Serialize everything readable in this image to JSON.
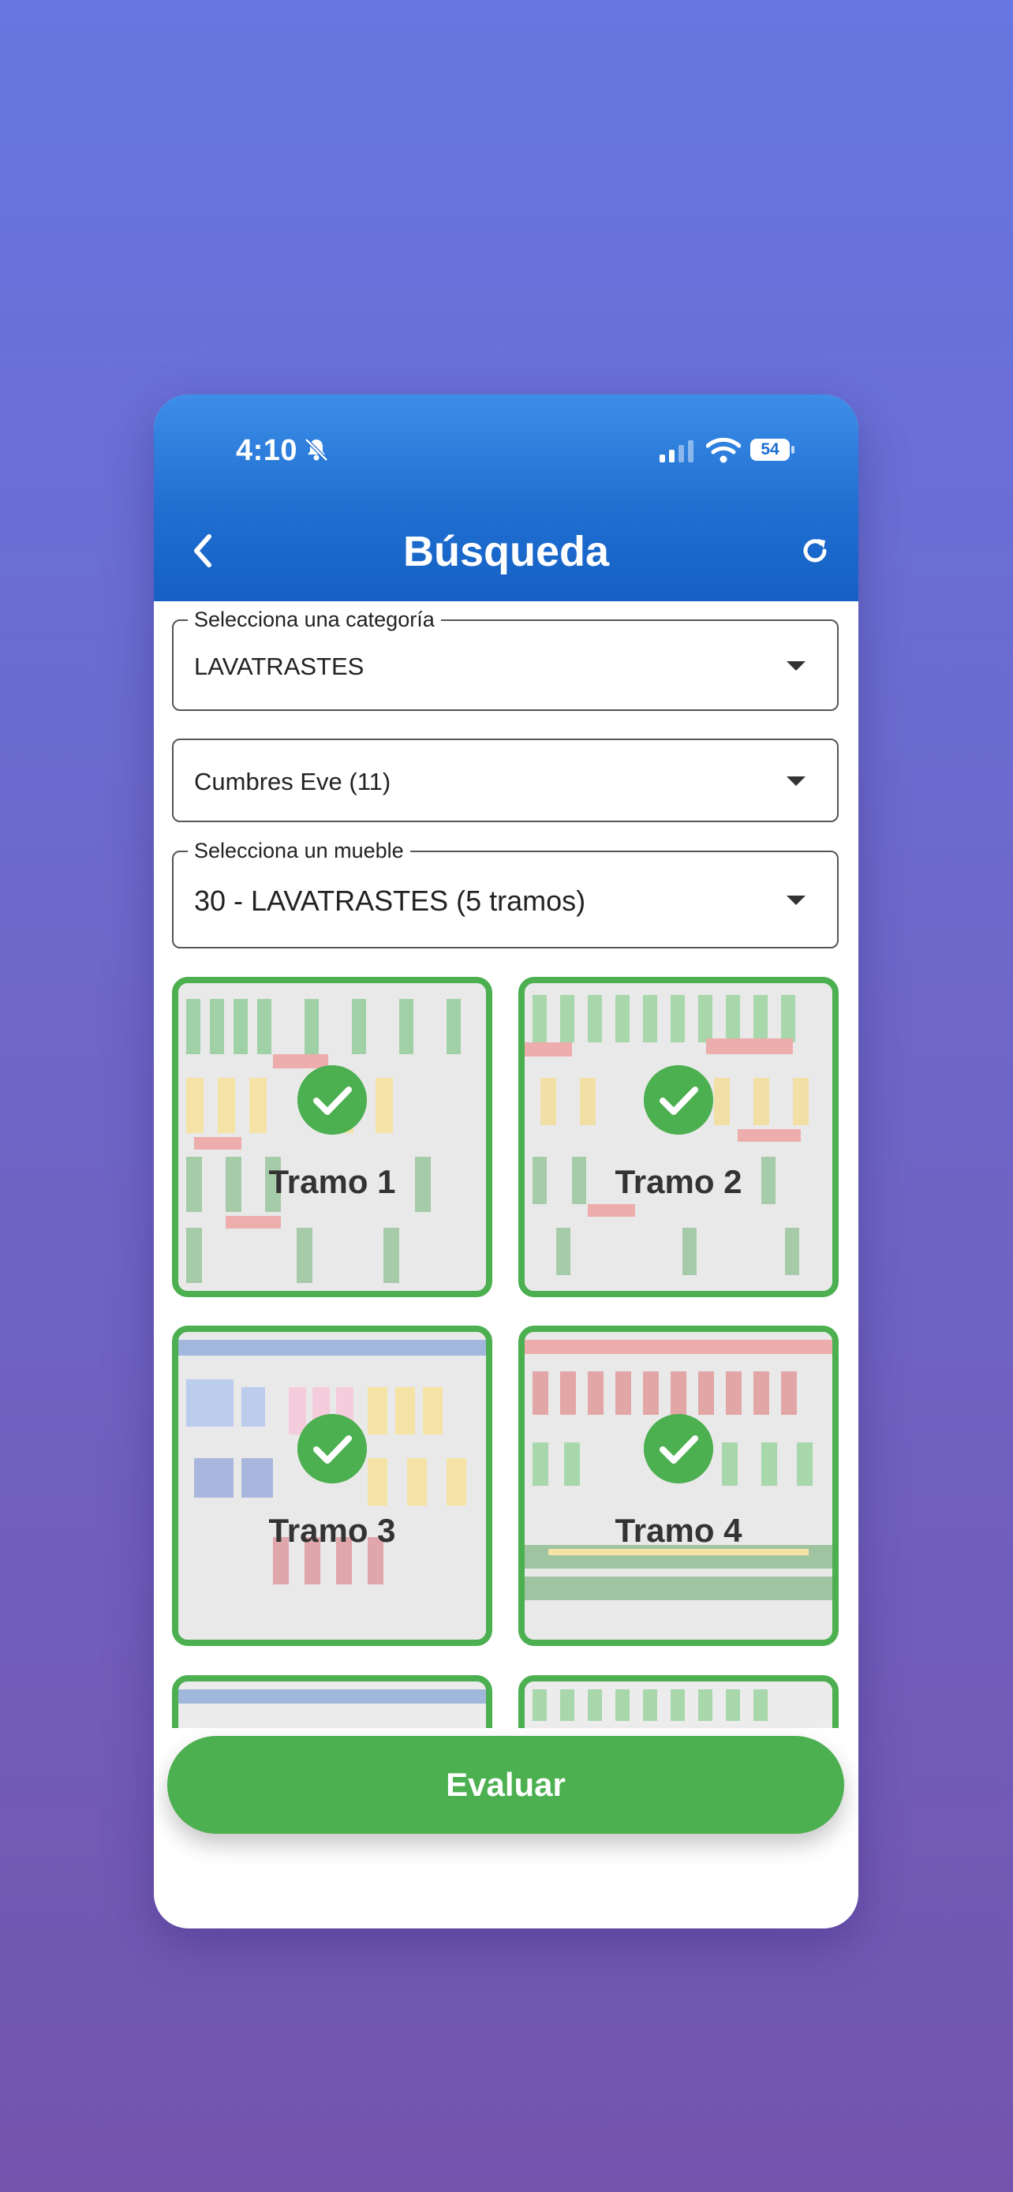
{
  "status_bar": {
    "time": "4:10",
    "battery": "54"
  },
  "appbar": {
    "title": "Búsqueda"
  },
  "category_select": {
    "label": "Selecciona una categoría",
    "value": "LAVATRASTES"
  },
  "store_select": {
    "value": "Cumbres Eve (11)"
  },
  "furniture_select": {
    "label": "Selecciona un mueble",
    "value": "30 - LAVATRASTES (5 tramos)"
  },
  "tiles": [
    {
      "label": "Tramo 1",
      "checked": true
    },
    {
      "label": "Tramo 2",
      "checked": true
    },
    {
      "label": "Tramo 3",
      "checked": true
    },
    {
      "label": "Tramo 4",
      "checked": true
    },
    {
      "label": "",
      "checked": false
    },
    {
      "label": "",
      "checked": false
    }
  ],
  "evaluate_button": {
    "label": "Evaluar"
  },
  "colors": {
    "accent_green": "#4caf50",
    "appbar_blue": "#1f6fd1",
    "background_top": "#6776e0",
    "background_bottom": "#7354ad"
  }
}
